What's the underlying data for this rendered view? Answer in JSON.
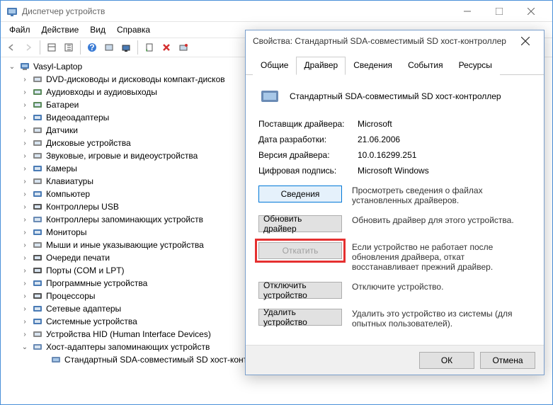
{
  "window": {
    "title": "Диспетчер устройств"
  },
  "menu": {
    "file": "Файл",
    "action": "Действие",
    "view": "Вид",
    "help": "Справка"
  },
  "tree": {
    "root": "Vasyl-Laptop",
    "items": [
      "DVD-дисководы и дисководы компакт-дисков",
      "Аудиовходы и аудиовыходы",
      "Батареи",
      "Видеоадаптеры",
      "Датчики",
      "Дисковые устройства",
      "Звуковые, игровые и видеоустройства",
      "Камеры",
      "Клавиатуры",
      "Компьютер",
      "Контроллеры USB",
      "Контроллеры запоминающих устройств",
      "Мониторы",
      "Мыши и иные указывающие устройства",
      "Очереди печати",
      "Порты (COM и LPT)",
      "Программные устройства",
      "Процессоры",
      "Сетевые адаптеры",
      "Системные устройства",
      "Устройства HID (Human Interface Devices)",
      "Хост-адаптеры запоминающих устройств"
    ],
    "child": "Стандартный SDA-совместимый SD хост-контроллер"
  },
  "dialog": {
    "title": "Свойства: Стандартный SDA-совместимый SD хост-контроллер",
    "tabs": {
      "general": "Общие",
      "driver": "Драйвер",
      "details": "Сведения",
      "events": "События",
      "resources": "Ресурсы"
    },
    "device_name": "Стандартный SDA-совместимый SD хост-контроллер",
    "rows": {
      "provider_label": "Поставщик драйвера:",
      "provider_value": "Microsoft",
      "date_label": "Дата разработки:",
      "date_value": "21.06.2006",
      "version_label": "Версия драйвера:",
      "version_value": "10.0.16299.251",
      "signature_label": "Цифровая подпись:",
      "signature_value": "Microsoft Windows"
    },
    "buttons": {
      "details": "Сведения",
      "details_desc": "Просмотреть сведения о файлах установленных драйверов.",
      "update": "Обновить драйвер",
      "update_desc": "Обновить драйвер для этого устройства.",
      "rollback": "Откатить",
      "rollback_desc": "Если устройство не работает после обновления драйвера, откат восстанавливает прежний драйвер.",
      "disable": "Отключить устройство",
      "disable_desc": "Отключите устройство.",
      "uninstall": "Удалить устройство",
      "uninstall_desc": "Удалить это устройство из системы (для опытных пользователей).",
      "ok": "ОК",
      "cancel": "Отмена"
    }
  }
}
